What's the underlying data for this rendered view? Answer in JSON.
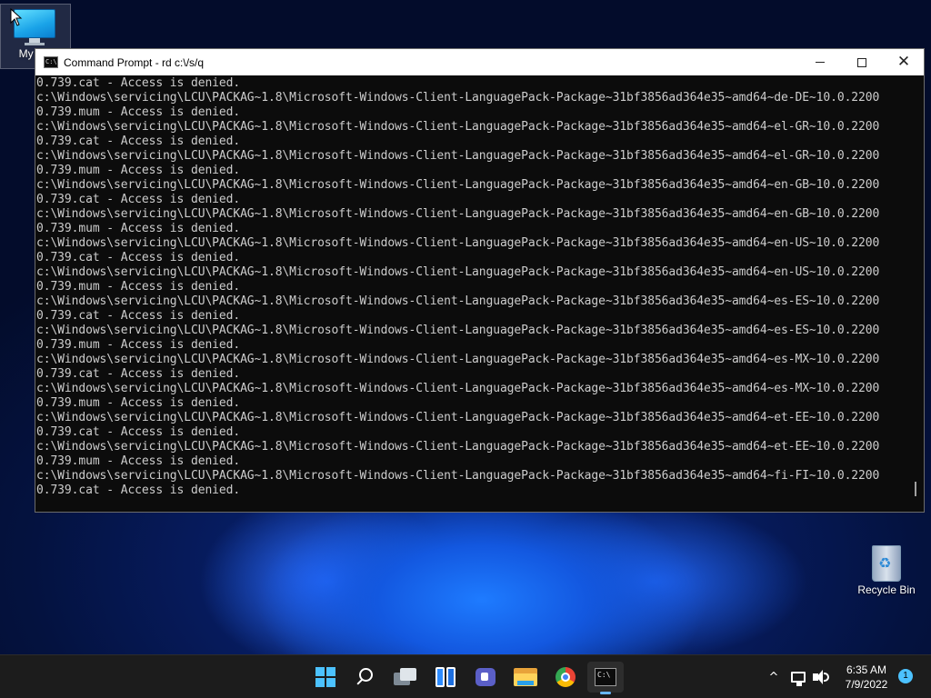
{
  "desktop": {
    "icons": [
      {
        "label": "My Computer",
        "visible_label": "My Co",
        "icon": "monitor-icon"
      },
      {
        "label": "Recycle Bin",
        "icon": "recycle-bin-icon"
      }
    ]
  },
  "window": {
    "title": "Command Prompt - rd  c:\\/s/q",
    "app_icon_text": "C:\\",
    "controls": {
      "minimize": "minimize",
      "maximize": "maximize",
      "close": "✕"
    },
    "lines": [
      "0.739.cat - Access is denied.",
      "c:\\Windows\\servicing\\LCU\\PACKAG~1.8\\Microsoft-Windows-Client-LanguagePack-Package~31bf3856ad364e35~amd64~de-DE~10.0.2200",
      "0.739.mum - Access is denied.",
      "c:\\Windows\\servicing\\LCU\\PACKAG~1.8\\Microsoft-Windows-Client-LanguagePack-Package~31bf3856ad364e35~amd64~el-GR~10.0.2200",
      "0.739.cat - Access is denied.",
      "c:\\Windows\\servicing\\LCU\\PACKAG~1.8\\Microsoft-Windows-Client-LanguagePack-Package~31bf3856ad364e35~amd64~el-GR~10.0.2200",
      "0.739.mum - Access is denied.",
      "c:\\Windows\\servicing\\LCU\\PACKAG~1.8\\Microsoft-Windows-Client-LanguagePack-Package~31bf3856ad364e35~amd64~en-GB~10.0.2200",
      "0.739.cat - Access is denied.",
      "c:\\Windows\\servicing\\LCU\\PACKAG~1.8\\Microsoft-Windows-Client-LanguagePack-Package~31bf3856ad364e35~amd64~en-GB~10.0.2200",
      "0.739.mum - Access is denied.",
      "c:\\Windows\\servicing\\LCU\\PACKAG~1.8\\Microsoft-Windows-Client-LanguagePack-Package~31bf3856ad364e35~amd64~en-US~10.0.2200",
      "0.739.cat - Access is denied.",
      "c:\\Windows\\servicing\\LCU\\PACKAG~1.8\\Microsoft-Windows-Client-LanguagePack-Package~31bf3856ad364e35~amd64~en-US~10.0.2200",
      "0.739.mum - Access is denied.",
      "c:\\Windows\\servicing\\LCU\\PACKAG~1.8\\Microsoft-Windows-Client-LanguagePack-Package~31bf3856ad364e35~amd64~es-ES~10.0.2200",
      "0.739.cat - Access is denied.",
      "c:\\Windows\\servicing\\LCU\\PACKAG~1.8\\Microsoft-Windows-Client-LanguagePack-Package~31bf3856ad364e35~amd64~es-ES~10.0.2200",
      "0.739.mum - Access is denied.",
      "c:\\Windows\\servicing\\LCU\\PACKAG~1.8\\Microsoft-Windows-Client-LanguagePack-Package~31bf3856ad364e35~amd64~es-MX~10.0.2200",
      "0.739.cat - Access is denied.",
      "c:\\Windows\\servicing\\LCU\\PACKAG~1.8\\Microsoft-Windows-Client-LanguagePack-Package~31bf3856ad364e35~amd64~es-MX~10.0.2200",
      "0.739.mum - Access is denied.",
      "c:\\Windows\\servicing\\LCU\\PACKAG~1.8\\Microsoft-Windows-Client-LanguagePack-Package~31bf3856ad364e35~amd64~et-EE~10.0.2200",
      "0.739.cat - Access is denied.",
      "c:\\Windows\\servicing\\LCU\\PACKAG~1.8\\Microsoft-Windows-Client-LanguagePack-Package~31bf3856ad364e35~amd64~et-EE~10.0.2200",
      "0.739.mum - Access is denied.",
      "c:\\Windows\\servicing\\LCU\\PACKAG~1.8\\Microsoft-Windows-Client-LanguagePack-Package~31bf3856ad364e35~amd64~fi-FI~10.0.2200",
      "0.739.cat - Access is denied."
    ]
  },
  "taskbar": {
    "items": [
      {
        "name": "start",
        "icon": "windows-logo-icon"
      },
      {
        "name": "search",
        "icon": "search-icon"
      },
      {
        "name": "task-view",
        "icon": "task-view-icon"
      },
      {
        "name": "widgets",
        "icon": "widgets-icon"
      },
      {
        "name": "chat",
        "icon": "teams-chat-icon"
      },
      {
        "name": "file-explorer",
        "icon": "folder-icon"
      },
      {
        "name": "chrome",
        "icon": "chrome-icon"
      },
      {
        "name": "command-prompt",
        "icon": "terminal-icon",
        "active": true
      }
    ],
    "tray": {
      "chevron": "^",
      "time": "6:35 AM",
      "date": "7/9/2022",
      "notifications": "1"
    }
  },
  "colors": {
    "console_bg": "#0c0c0c",
    "console_text": "#cccccc",
    "taskbar_bg": "#1c1c1c",
    "accent": "#4cc2ff"
  }
}
